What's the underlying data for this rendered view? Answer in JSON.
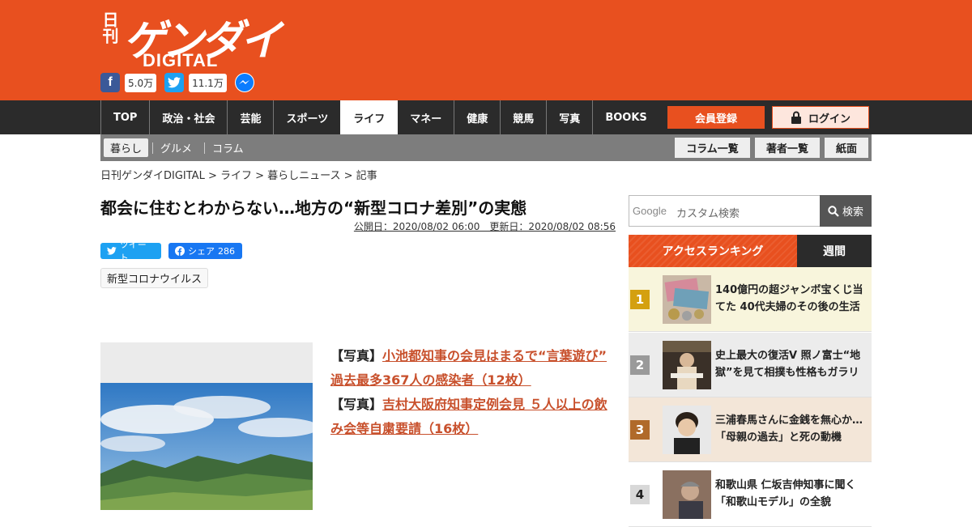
{
  "header": {
    "logo_small": "日刊",
    "logo_large": "ゲンダイ",
    "logo_sub": "DIGITAL",
    "facebook_count": "5.0万",
    "twitter_count": "11.1万",
    "brand_color": "#e8501f"
  },
  "nav": {
    "items": [
      "TOP",
      "政治・社会",
      "芸能",
      "スポーツ",
      "ライフ",
      "マネー",
      "健康",
      "競馬",
      "写真",
      "BOOKS"
    ],
    "active": "ライフ",
    "register_label": "会員登録",
    "login_label": "ログイン"
  },
  "subnav": {
    "items": [
      "暮らし",
      "グルメ",
      "コラム"
    ],
    "active": "暮らし",
    "buttons": [
      "コラム一覧",
      "著者一覧",
      "紙面"
    ]
  },
  "breadcrumb": "日刊ゲンダイDIGITAL > ライフ > 暮らしニュース > 記事",
  "article": {
    "title": "都会に住むとわからない…地方の“新型コロナ差別”の実態",
    "dates": "公開日：2020/08/02 06:00　更新日：2020/08/02 08:56",
    "tweet_label": "ツイート",
    "share_label": "シェア",
    "share_count": "286",
    "tag": "新型コロナウイルス",
    "related": [
      {
        "prefix": "【写真】",
        "link": "小池都知事の会見はまるで“言葉遊び” 過去最多367人の感染者（12枚）"
      },
      {
        "prefix": "【写真】",
        "link": "吉村大阪府知事定例会見 ５人以上の飲み会等自粛要請（16枚）"
      }
    ]
  },
  "sidebar": {
    "search_brand": "Google",
    "search_placeholder": "カスタム検索",
    "search_button": "検索",
    "ranking_tab": "アクセスランキング",
    "weekly_tab": "週間",
    "ranking": [
      {
        "rank": "1",
        "title": "140億円の超ジャンボ宝くじ当てた 40代夫婦のその後の生活",
        "color": "#d4a010",
        "bg": "#f8f5dc"
      },
      {
        "rank": "2",
        "title": "史上最大の復活V 照ノ富士“地獄”を見て相撲も性格もガラリ",
        "color": "#9a9a9a",
        "bg": "#ececec"
      },
      {
        "rank": "3",
        "title": "三浦春馬さんに金銭を無心か…「母親の過去」と死の動機",
        "color": "#b06a2a",
        "bg": "#f3e6d8"
      },
      {
        "rank": "4",
        "title": "和歌山県 仁坂吉伸知事に聞く「和歌山モデル」の全貌",
        "color": "#9a9a9a",
        "bg": "#ffffff"
      }
    ]
  }
}
